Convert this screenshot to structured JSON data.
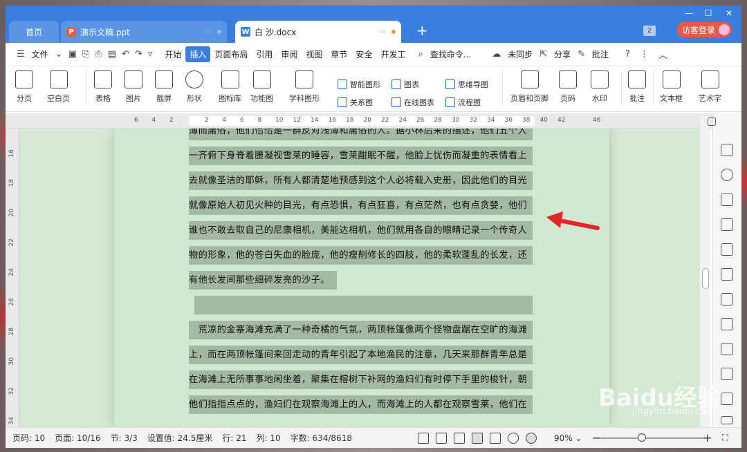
{
  "tabs": {
    "home": "首页",
    "ppt": "演示文稿.ppt",
    "doc": "白 沙.docx",
    "page_count_badge": "2",
    "guest": "访客登录"
  },
  "menu": {
    "file": "文件",
    "items": [
      "开始",
      "插入",
      "页面布局",
      "引用",
      "审阅",
      "视图",
      "章节",
      "安全",
      "开发工"
    ],
    "search": "查找命令...",
    "sync": "未同步",
    "share": "分享",
    "annotate": "批注",
    "help": "?"
  },
  "ribbon": {
    "page_break": "分页",
    "blank_page": "空白页",
    "table": "表格",
    "picture": "图片",
    "screenshot": "截屏",
    "shapes": "形状",
    "icon_lib": "图标库",
    "func_chart": "功能图",
    "subject_chart": "学科图形",
    "smart_graphic": "智能图形",
    "chart": "图表",
    "mindmap": "思维导图",
    "relation": "关系图",
    "online_chart": "在线图表",
    "flowchart": "流程图",
    "header_footer": "页眉和页脚",
    "page_number": "页码",
    "watermark": "水印",
    "comment": "批注",
    "textbox": "文本框",
    "wordart": "艺术字"
  },
  "ruler_ticks": [
    "6",
    "4",
    "2",
    "",
    "2",
    "4",
    "6",
    "8",
    "10",
    "12",
    "14",
    "16",
    "18",
    "20",
    "22",
    "24",
    "26",
    "28",
    "30",
    "32",
    "34",
    "36",
    "38",
    "40",
    "42",
    "",
    "46"
  ],
  "vruler_ticks": [
    "16",
    "18",
    "20",
    "22",
    "24",
    "26",
    "28",
    "30",
    "32",
    "34"
  ],
  "document": {
    "lines": [
      "薄而庸俗，他们恰恰是一群反对浅薄和庸俗的人。据小林后来的描述，他们五个人",
      "一齐俯下身脊着腰凝视雪莱的睡容，雪莱酣眠不醒，他脸上忧伤而凝重的表情看上",
      "去就像圣洁的耶稣，所有人都清楚地预感到这个人必将载入史册，因此他们的目光",
      "就像原始人初见火种的目光，有点恐惧，有点狂喜，有点茫然，也有点贪婪，他们",
      "谁也不敢去取自己的尼康相机，美能达相机，他们就用各自的眼睛记录一个传奇人",
      "物的形象，他的苍白失血的脸庞，他的瘦削修长的四肢，他的柔软蓬乱的长发，还",
      "有他长发间那些细碎发亮的沙子。",
      "",
      "　荒凉的金寨海滩充满了一种奇橘的气氛，两顶帐篷像两个怪物盘踞在空旷的海滩",
      "上，而在两顶帐篷间来回走动的青年引起了本地渔民的注意，几天来那群青年总是",
      "在海滩上无所事事地闲坐着，聚集在榕树下补网的渔妇们有时停下手里的梭针，朝",
      "他们指指点点的，渔妇们在观察海滩上的人，而海滩上的人都在观察雪莱，他们在"
    ]
  },
  "status": {
    "page": "页码: 10",
    "pages": "页面: 10/16",
    "section": "节: 3/3",
    "setting": "设置值: 24.5厘米",
    "row": "行: 21",
    "col": "列: 10",
    "words": "字数: 634/8618",
    "zoom": "90%",
    "zoom_level": 0.45
  },
  "watermark": {
    "brand": "Baidu经验",
    "url": "jingyan.baidu.com"
  },
  "colors": {
    "accent": "#3a7ee0",
    "eye_care_bg": "#d4e8d4",
    "selection": "#a3b9a3",
    "guest_btn": "#e35a4c",
    "arrow": "#e3262b"
  }
}
